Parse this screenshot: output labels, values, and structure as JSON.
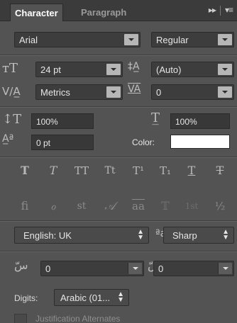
{
  "tabs": {
    "character": "Character",
    "paragraph": "Paragraph",
    "menu_glyph": "▸▸"
  },
  "font": {
    "family": "Arial",
    "style": "Regular"
  },
  "size": {
    "font_size": "24 pt",
    "leading": "(Auto)"
  },
  "kerning": {
    "kerning": "Metrics",
    "tracking": "0"
  },
  "scale": {
    "vertical": "100%",
    "horizontal": "100%"
  },
  "baseline": {
    "shift": "0 pt",
    "color_label": "Color:",
    "color_value": "#ffffff"
  },
  "type_styles": [
    "T",
    "T",
    "TT",
    "Tt",
    "T¹",
    "T₁",
    "T",
    "T"
  ],
  "opentype": [
    "ﬁ",
    "ℴ",
    "st",
    "𝒜",
    "aa",
    "𝕋",
    "1st",
    "½"
  ],
  "language": {
    "value": "English: UK",
    "aa_icon": "ªa",
    "antialias": "Sharp"
  },
  "arabic": {
    "kashida": "0",
    "diacritic": "0"
  },
  "digits": {
    "label": "Digits:",
    "value": "Arabic (01..."
  },
  "justification": {
    "label": "Justification Alternates"
  }
}
